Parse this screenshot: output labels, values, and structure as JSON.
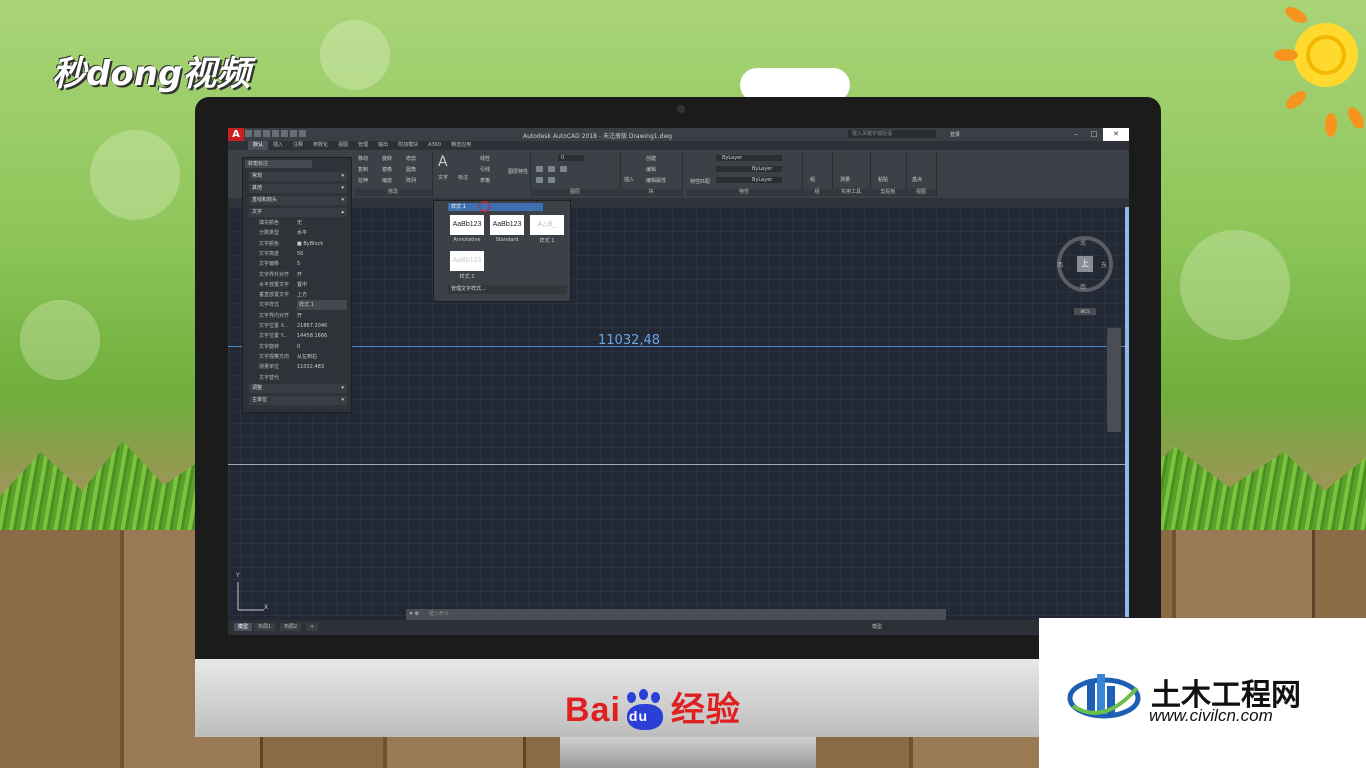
{
  "brand": {
    "miao_logo": "秒dong视频",
    "baidu_text": "Bai",
    "baidu_du": "du",
    "baidu_suffix": "经验",
    "civil_name": "土木工程网",
    "civil_url": "www.civilcn.com"
  },
  "window": {
    "title": "Autodesk AutoCAD 2018 - 未注册版    Drawing1.dwg",
    "search_placeholder": "键入关键字或短语",
    "login": "登录",
    "controls": [
      "–",
      "□",
      "✕"
    ]
  },
  "ribbon_tabs": [
    "默认",
    "插入",
    "注释",
    "参数化",
    "视图",
    "管理",
    "输出",
    "附加模块",
    "A360",
    "精选应用"
  ],
  "ribbon_groups": [
    "修改",
    "图层",
    "块",
    "特性",
    "组",
    "实用工具",
    "剪贴板",
    "视图"
  ],
  "ribbon_labels": {
    "text": "文字",
    "dim": "标注",
    "linear": "线性",
    "leader": "引线",
    "table": "表格",
    "layer_props": "图层特性",
    "insert": "插入",
    "create": "创建",
    "edit": "编辑",
    "edit_attr": "编辑属性",
    "match": "特性匹配",
    "bylayer1": "ByLayer",
    "bylayer2": "ByLayer",
    "bylayer3": "ByLayer",
    "group": "组",
    "measure": "测量",
    "paste": "粘贴",
    "base": "基点",
    "layer_num": "0",
    "move": "移动",
    "rotate": "旋转",
    "copy": "复制",
    "mirror": "镜像",
    "stretch": "拉伸",
    "scale": "缩放",
    "trim": "修剪",
    "fillet": "圆角",
    "array": "阵列"
  },
  "properties": {
    "selector": "转角标注",
    "sections": [
      "常规",
      "其他",
      "直线和箭头"
    ],
    "text_section": "文字",
    "rows": [
      {
        "k": "填充颜色",
        "v": "无"
      },
      {
        "k": "分数类型",
        "v": "水平"
      },
      {
        "k": "文字颜色",
        "v": "■ ByBlock"
      },
      {
        "k": "文字高度",
        "v": "50"
      },
      {
        "k": "文字偏移",
        "v": "5"
      },
      {
        "k": "文字界外对齐",
        "v": "开"
      },
      {
        "k": "水平放置文字",
        "v": "置中"
      },
      {
        "k": "垂直放置文字",
        "v": "上方"
      },
      {
        "k": "文字样式",
        "v": "样式 1"
      },
      {
        "k": "文字界内对齐",
        "v": "开"
      },
      {
        "k": "文字位置 X...",
        "v": "21867.2046"
      },
      {
        "k": "文字位置 Y...",
        "v": "14458.1666"
      },
      {
        "k": "文字旋转",
        "v": "0"
      },
      {
        "k": "文字观察方向",
        "v": "从左到右"
      },
      {
        "k": "测量单位",
        "v": "11032.483"
      },
      {
        "k": "文字替代",
        "v": ""
      }
    ],
    "tail_sections": [
      "调整",
      "主单位"
    ]
  },
  "style_dropdown": {
    "current": "样式 1",
    "swatches": [
      {
        "sample": "AaBb123",
        "label": "Annotative"
      },
      {
        "sample": "AaBb123",
        "label": "Standard"
      },
      {
        "sample": "A△B_",
        "label": "样式 1"
      },
      {
        "sample": "AaBb123",
        "label": "样式 2"
      }
    ],
    "manage": "管理文字样式..."
  },
  "drawing": {
    "dimension_value": "11032,48"
  },
  "viewcube": {
    "north": "北",
    "south": "南",
    "east": "东",
    "west": "西",
    "top": "上",
    "wcs": "WCS"
  },
  "ucs": {
    "x": "X",
    "y": "Y"
  },
  "command": {
    "placeholder": "键入命令"
  },
  "layout_tabs": [
    "模型",
    "布局1",
    "布局2",
    "+"
  ],
  "status": {
    "model": "模型"
  }
}
